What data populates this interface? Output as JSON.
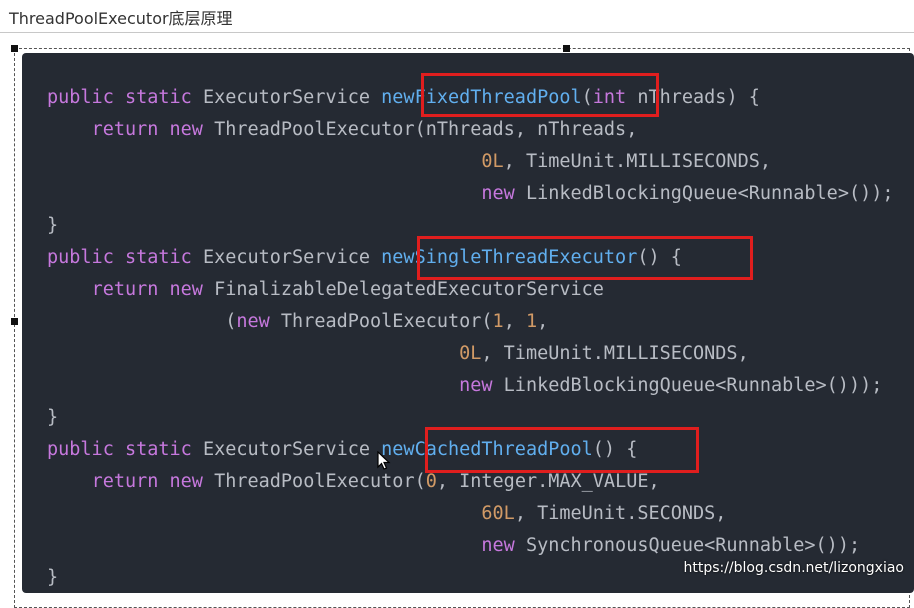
{
  "header": {
    "title": "ThreadPoolExecutor底层原理"
  },
  "code": {
    "lines": [
      [
        {
          "t": "public static ",
          "c": "kw"
        },
        {
          "t": "ExecutorService ",
          "c": "p"
        },
        {
          "t": "newFixedThreadPool",
          "c": "fn"
        },
        {
          "t": "(",
          "c": "p"
        },
        {
          "t": "int ",
          "c": "kw"
        },
        {
          "t": "nThreads) {",
          "c": "p"
        }
      ],
      [
        {
          "t": "    ",
          "c": "p"
        },
        {
          "t": "return new ",
          "c": "kw"
        },
        {
          "t": "ThreadPoolExecutor(nThreads, nThreads,",
          "c": "p"
        }
      ],
      [
        {
          "t": "                                       ",
          "c": "p"
        },
        {
          "t": "0L",
          "c": "num"
        },
        {
          "t": ", TimeUnit.MILLISECONDS,",
          "c": "p"
        }
      ],
      [
        {
          "t": "                                       ",
          "c": "p"
        },
        {
          "t": "new ",
          "c": "kw"
        },
        {
          "t": "LinkedBlockingQueue<Runnable>());",
          "c": "p"
        }
      ],
      [
        {
          "t": "}",
          "c": "p"
        }
      ],
      [
        {
          "t": "public static ",
          "c": "kw"
        },
        {
          "t": "ExecutorService ",
          "c": "p"
        },
        {
          "t": "newSingleThreadExecutor",
          "c": "fn"
        },
        {
          "t": "() {",
          "c": "p"
        }
      ],
      [
        {
          "t": "    ",
          "c": "p"
        },
        {
          "t": "return new ",
          "c": "kw"
        },
        {
          "t": "FinalizableDelegatedExecutorService",
          "c": "p"
        }
      ],
      [
        {
          "t": "                ",
          "c": "p"
        },
        {
          "t": "(",
          "c": "p"
        },
        {
          "t": "new ",
          "c": "kw"
        },
        {
          "t": "ThreadPoolExecutor(",
          "c": "p"
        },
        {
          "t": "1",
          "c": "num"
        },
        {
          "t": ", ",
          "c": "p"
        },
        {
          "t": "1",
          "c": "num"
        },
        {
          "t": ",",
          "c": "p"
        }
      ],
      [
        {
          "t": "                                     ",
          "c": "p"
        },
        {
          "t": "0L",
          "c": "num"
        },
        {
          "t": ", TimeUnit.MILLISECONDS,",
          "c": "p"
        }
      ],
      [
        {
          "t": "                                     ",
          "c": "p"
        },
        {
          "t": "new ",
          "c": "kw"
        },
        {
          "t": "LinkedBlockingQueue<Runnable>()));",
          "c": "p"
        }
      ],
      [
        {
          "t": "}",
          "c": "p"
        }
      ],
      [
        {
          "t": "public static ",
          "c": "kw"
        },
        {
          "t": "ExecutorService ",
          "c": "p"
        },
        {
          "t": "newCachedThreadPool",
          "c": "fn"
        },
        {
          "t": "() {",
          "c": "p"
        }
      ],
      [
        {
          "t": "    ",
          "c": "p"
        },
        {
          "t": "return new ",
          "c": "kw"
        },
        {
          "t": "ThreadPoolExecutor(",
          "c": "p"
        },
        {
          "t": "0",
          "c": "num"
        },
        {
          "t": ", Integer.MAX_VALUE,",
          "c": "p"
        }
      ],
      [
        {
          "t": "                                       ",
          "c": "p"
        },
        {
          "t": "60L",
          "c": "num"
        },
        {
          "t": ", TimeUnit.SECONDS,",
          "c": "p"
        }
      ],
      [
        {
          "t": "                                       ",
          "c": "p"
        },
        {
          "t": "new ",
          "c": "kw"
        },
        {
          "t": "SynchronousQueue<Runnable>());",
          "c": "p"
        }
      ],
      [
        {
          "t": "}",
          "c": "p"
        }
      ]
    ]
  },
  "colors": {
    "editor_bg": "#252a33",
    "keyword": "#c678dd",
    "function": "#61afef",
    "number": "#d19a66",
    "plain": "#b8bcc4",
    "highlight_box": "#e01e1e"
  },
  "watermark": "https://blog.csdn.net/lizongxiao"
}
